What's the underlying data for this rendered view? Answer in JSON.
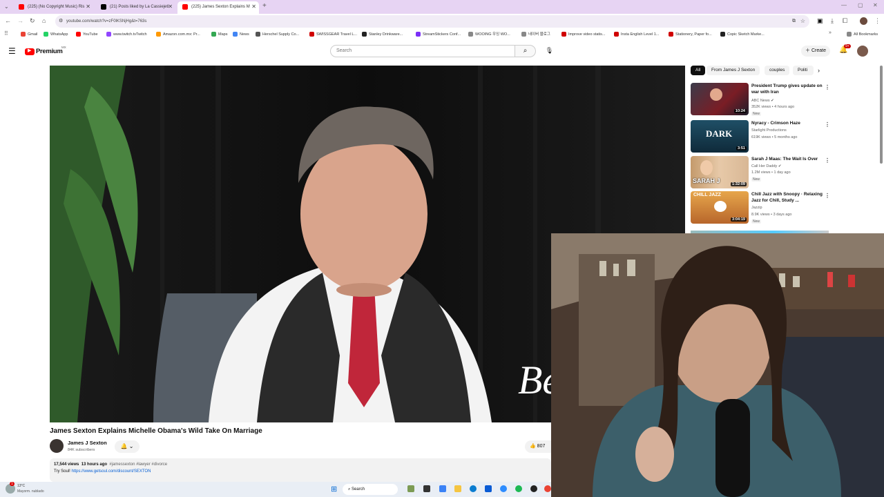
{
  "browser": {
    "tabs": [
      {
        "title": "(225) (No Copyright Music) Ris",
        "fav_color": "#ff0000"
      },
      {
        "title": "(21) Posts liked by La Cassiejeti",
        "fav_color": "#000000"
      },
      {
        "title": "(225) James Sexton Explains M",
        "fav_color": "#ff0000"
      }
    ],
    "url": "youtube.com/watch?v=zF0lKSNjHg&t=763s",
    "bookmarks": [
      {
        "label": "Gmail",
        "color": "#ea4335"
      },
      {
        "label": "WhatsApp",
        "color": "#25d366"
      },
      {
        "label": "YouTube",
        "color": "#ff0000"
      },
      {
        "label": "www.twitch.tvTwitch",
        "color": "#9146ff"
      },
      {
        "label": "Amazon.com.mx: Pr...",
        "color": "#ff9900"
      },
      {
        "label": "Maps",
        "color": "#34a853"
      },
      {
        "label": "News",
        "color": "#4285f4"
      },
      {
        "label": "Herschel Supply Co...",
        "color": "#555555"
      },
      {
        "label": "SWISSGEAR Travel L...",
        "color": "#d00000"
      },
      {
        "label": "Stanley Drinkware...",
        "color": "#222222"
      },
      {
        "label": "StreamStickers Conf...",
        "color": "#7b2ff7"
      },
      {
        "label": "WOOING 우잉 WO...",
        "color": "#888888"
      },
      {
        "label": "네이버 블로그",
        "color": "#888888"
      },
      {
        "label": "Improve video statis...",
        "color": "#d00000"
      },
      {
        "label": "Insta English Level 1...",
        "color": "#d00000"
      },
      {
        "label": "Stationery, Paper fo...",
        "color": "#d00000"
      },
      {
        "label": "Copic Sketch Marke...",
        "color": "#222222"
      }
    ],
    "all_bookmarks": "All Bookmarks"
  },
  "header": {
    "logo": "Premium",
    "logo_region": "MX",
    "search_placeholder": "Search",
    "create_label": "Create",
    "notif_count": "9+"
  },
  "video": {
    "title": "James Sexton Explains Michelle Obama's Wild Take On Marriage",
    "overlay_text": "Be",
    "channel": "James J Sexton",
    "subscribers": "84K subscribers",
    "likes": "807",
    "views": "17,544 views",
    "uploaded": "13 hours ago",
    "hashtags": "#jamessexton #lawyer #divorce",
    "desc_prefix": "Try Soul!",
    "desc_link": "https://www.getsoul.com/discount/SEXTON"
  },
  "sidebar": {
    "chips": [
      "All",
      "From James J Sexton",
      "couples",
      "Politi"
    ],
    "recs": [
      {
        "title": "President Trump gives update on war with Iran",
        "channel": "ABC News",
        "meta": "352K views • 4 hours ago",
        "new": "New",
        "duration": "10:24"
      },
      {
        "title": "Nyracy - Crimson Haze",
        "channel": "Starlight Productions",
        "meta": "619K views • 5 months ago",
        "new": "",
        "duration": "3:51",
        "thumb_text": "DARK"
      },
      {
        "title": "Sarah J Maas: The Wait Is Over",
        "channel": "Call Her Daddy",
        "meta": "1.2M views • 1 day ago",
        "new": "New",
        "duration": "1:32:09",
        "thumb_text": "SARAH J"
      },
      {
        "title": "Chill Jazz with Snoopy · Relaxing Jazz for Chill, Study ...",
        "channel": "Jazzip",
        "meta": "8.9K views • 3 days ago",
        "new": "New",
        "duration": "3:04:19",
        "thumb_text": "CHILL JAZZ"
      }
    ]
  },
  "taskbar": {
    "weather_temp": "13°C",
    "weather_desc": "Mayorm. nublado",
    "search": "Search"
  }
}
